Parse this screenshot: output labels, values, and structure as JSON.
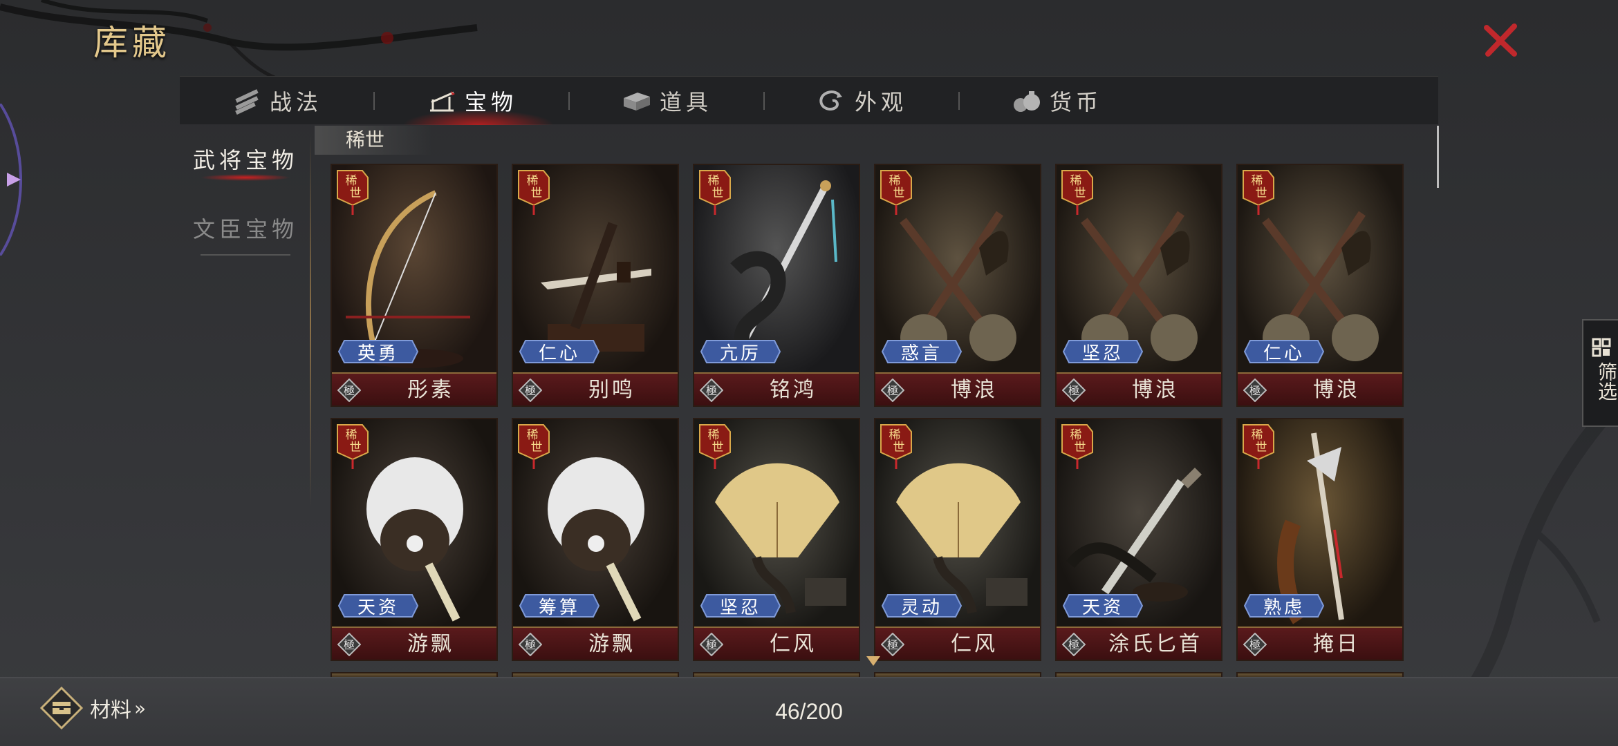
{
  "title": "库藏",
  "tabs": [
    {
      "label": "战法",
      "icon": "scroll-bundle-icon",
      "active": false
    },
    {
      "label": "宝物",
      "icon": "weapon-rack-icon",
      "active": true
    },
    {
      "label": "道具",
      "icon": "box-icon",
      "active": false
    },
    {
      "label": "外观",
      "icon": "swirl-icon",
      "active": false
    },
    {
      "label": "货币",
      "icon": "money-bag-icon",
      "active": false
    }
  ],
  "side": [
    {
      "label": "武将宝物",
      "active": true
    },
    {
      "label": "文臣宝物",
      "active": false
    }
  ],
  "section_label": "稀世",
  "cards": [
    {
      "rarity": "稀世",
      "trait": "英勇",
      "grade": "極",
      "name": "彤素",
      "art": "bow"
    },
    {
      "rarity": "稀世",
      "trait": "仁心",
      "grade": "極",
      "name": "别鸣",
      "art": "sword-stand"
    },
    {
      "rarity": "稀世",
      "trait": "亢厉",
      "grade": "極",
      "name": "铭鸿",
      "art": "dragon-sword"
    },
    {
      "rarity": "稀世",
      "trait": "惑言",
      "grade": "極",
      "name": "博浪",
      "art": "hammers"
    },
    {
      "rarity": "稀世",
      "trait": "坚忍",
      "grade": "極",
      "name": "博浪",
      "art": "hammers"
    },
    {
      "rarity": "稀世",
      "trait": "仁心",
      "grade": "極",
      "name": "博浪",
      "art": "hammers"
    },
    {
      "rarity": "稀世",
      "trait": "天资",
      "grade": "極",
      "name": "游飘",
      "art": "feather-fan"
    },
    {
      "rarity": "稀世",
      "trait": "筹算",
      "grade": "極",
      "name": "游飘",
      "art": "feather-fan"
    },
    {
      "rarity": "稀世",
      "trait": "坚忍",
      "grade": "極",
      "name": "仁风",
      "art": "folding-fan"
    },
    {
      "rarity": "稀世",
      "trait": "灵动",
      "grade": "極",
      "name": "仁风",
      "art": "folding-fan"
    },
    {
      "rarity": "稀世",
      "trait": "天资",
      "grade": "極",
      "name": "涂氏匕首",
      "art": "dagger"
    },
    {
      "rarity": "稀世",
      "trait": "熟虑",
      "grade": "極",
      "name": "掩日",
      "art": "halberd"
    }
  ],
  "filter_label": "筛选",
  "materials_label": "材料",
  "materials_arrow": "»",
  "count": "46/200",
  "colors": {
    "accent_gold": "#e3c88c",
    "tab_active_glow": "#c81e1e",
    "trait_badge": "#3d5aa0",
    "name_bar": "#4a1416",
    "close": "#c0282c"
  }
}
